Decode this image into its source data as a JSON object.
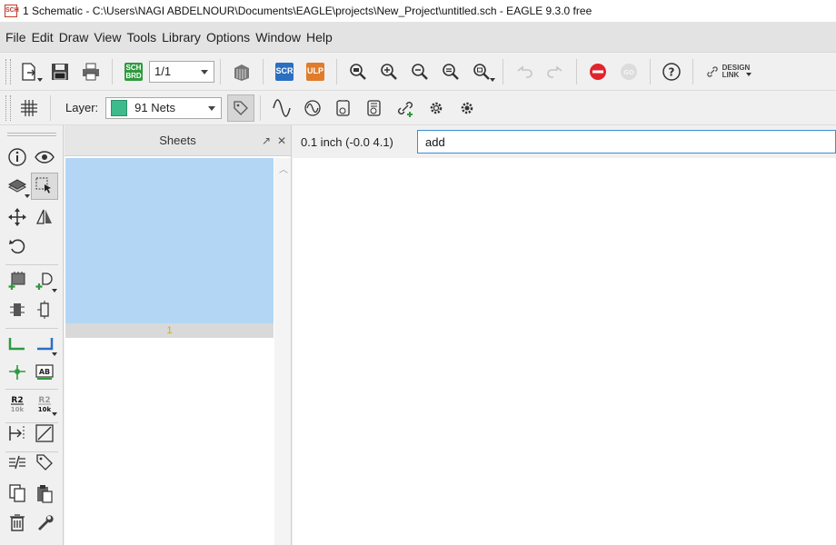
{
  "window": {
    "app_icon": "SCH",
    "title": "1 Schematic - C:\\Users\\NAGI ABDELNOUR\\Documents\\EAGLE\\projects\\New_Project\\untitled.sch - EAGLE 9.3.0 free"
  },
  "menu": [
    "File",
    "Edit",
    "Draw",
    "View",
    "Tools",
    "Library",
    "Options",
    "Window",
    "Help"
  ],
  "toolbar": {
    "sheet_select": "1/1",
    "sch_brd_top": "SCH",
    "sch_brd_bottom": "BRD",
    "scr_label": "SCR",
    "ulp_label": "ULP",
    "design_link_top": "DESIGN",
    "design_link_bottom": "LINK",
    "colors": {
      "stop": "#e0252d",
      "go": "#cfcfcf"
    }
  },
  "toolbar2": {
    "layer_label": "Layer:",
    "layer_value": "91 Nets",
    "layer_color": "#3dbb8c"
  },
  "palette": {
    "name_label_top": "AB",
    "value_r2": "R2",
    "value_10k": "10k"
  },
  "sheets": {
    "title": "Sheets",
    "sheet_number": "1"
  },
  "command": {
    "coordinates": "0.1 inch (-0.0 4.1)",
    "value": "add"
  }
}
